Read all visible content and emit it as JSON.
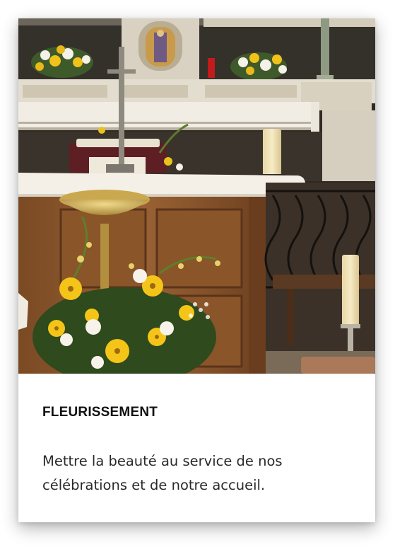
{
  "card": {
    "title": "FLEURISSEMENT",
    "description": "Mettre la beauté au service de nos célébrations et de notre accueil."
  },
  "colors": {
    "title": "#111111",
    "text": "#2a2a2a",
    "card_background": "#ffffff"
  }
}
